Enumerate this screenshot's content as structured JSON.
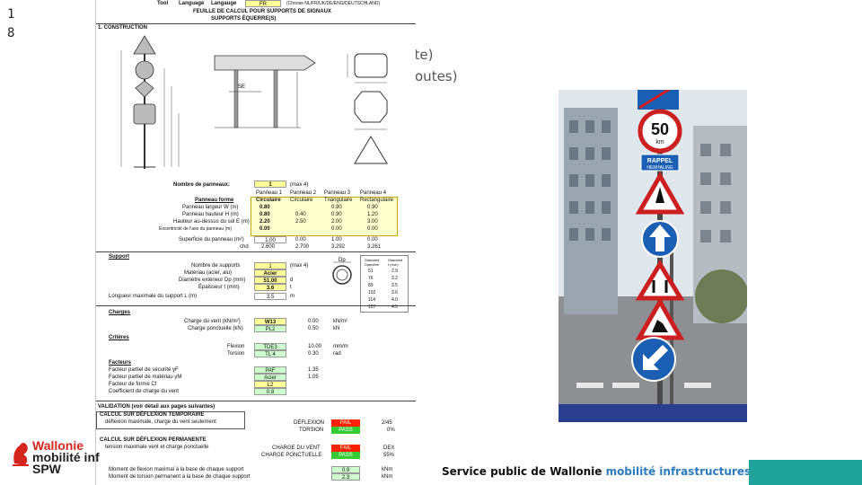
{
  "slide_number": "1 8",
  "background_text": [
    "ute)",
    "iroutes)"
  ],
  "sheet": {
    "header": {
      "tool": "Tool",
      "language_label": "Language",
      "language_label2": "Langauge",
      "language_value": "FR",
      "note": "(Choose NL/FR/UK/DE/ENG/DEUTSCHLAND)"
    },
    "title_line1": "FEUILLE DE CALCUL POUR SUPPORTS DE SIGNAUX",
    "title_line2": "SUPPORTS ÉQUERRE(S)",
    "section1": "1. CONSTRUCTION",
    "panels_count_label": "Nombre de panneaux:",
    "panels_count_value": "1",
    "panels_count_note": "(max 4)",
    "panel_headers": [
      "Panneau 1",
      "Panneau 2",
      "Panneau 3",
      "Panneau 4"
    ],
    "panel_rows": [
      {
        "label": "Panneau forme",
        "values": [
          "Circulaire",
          "Circulaire",
          "Triangulaire",
          "Rectangulaire"
        ]
      },
      {
        "label": "Panneau largeur W (m)",
        "values": [
          "0.80",
          "",
          "0.90",
          "0.90"
        ]
      },
      {
        "label": "Panneau hauteur H (m)",
        "values": [
          "0.80",
          "0.40",
          "0.90",
          "1.20"
        ]
      },
      {
        "label": "Hauteur au-dessus du sol E (m)",
        "values": [
          "2.20",
          "2.50",
          "2.00",
          "3.00"
        ]
      },
      {
        "label": "Excentricité de l'axe du panneau (m)",
        "values": [
          "0.00",
          "",
          "0.00",
          "0.00"
        ]
      },
      {
        "label": "Superficie du panneau (m²)",
        "values": [
          "1.00",
          "0.00",
          "1.00",
          "0.00"
        ]
      },
      {
        "label": "chd",
        "values": [
          "2.600",
          "2.700",
          "3.292",
          "3.261"
        ]
      }
    ],
    "support_title": "Support",
    "support_rows": [
      {
        "label": "Nombre de supports",
        "value": "1",
        "unit": "(max 4)"
      },
      {
        "label": "Matériau (acier, alu)",
        "value": "Acier",
        "unit": ""
      },
      {
        "label": "Diamètre extérieur Dp (mm)",
        "value": "51.00",
        "unit": "d"
      },
      {
        "label": "Épaisseur t (mm)",
        "value": "3.6",
        "unit": "t"
      }
    ],
    "support_length_label": "Longueur maximale du support L (m)",
    "support_length_value": "3.5",
    "support_length_unit": "m",
    "charges_title": "Charges",
    "charges_rows": [
      {
        "label": "Charge du vent (kN/m²)",
        "code": "W13",
        "value": "0.00",
        "unit": "kN/m²"
      },
      {
        "label": "Charge ponctuelle (kN)",
        "code": "PL2",
        "value": "0.50",
        "unit": "kN"
      }
    ],
    "criteres_title": "Critères",
    "criteres_rows": [
      {
        "label": "Flexion",
        "code": "TDE3",
        "value": "10.00",
        "unit": "mm/m"
      },
      {
        "label": "Torsion",
        "code": "TL 4",
        "value": "0.30",
        "unit": "rad"
      }
    ],
    "facteurs_title": "Facteurs",
    "facteurs_rows": [
      {
        "label": "Facteur partiel de sécurité γF",
        "code": "PAF",
        "value": "1.35"
      },
      {
        "label": "Facteur partiel de matériau γM",
        "code": "Acier",
        "value": "1.05"
      },
      {
        "label": "Facteur de forme Cf",
        "code": "L2",
        "value": ""
      },
      {
        "label": "Coefficient de charge du vent",
        "code": "0.8",
        "value": ""
      }
    ],
    "validation_title": "VALIDATION (voir détail aux pages suivantes)",
    "calc_temp_title": "CALCUL SUR DÉFLEXION TEMPORAIRE",
    "calc_temp_sub": "déflexion maximale, charge du vent seulement",
    "calc_temp_rows": [
      {
        "label": "DÉFLEXION",
        "status": "FAIL",
        "value": "2/45"
      },
      {
        "label": "TORSION",
        "status": "PASS",
        "value": "0%"
      }
    ],
    "calc_perm_title": "CALCUL SUR DÉFLEXION PERMANENTE",
    "calc_perm_sub": "tension maximale vent et charge ponctuelle",
    "calc_perm_rows": [
      {
        "label": "CHARGE DU VENT",
        "status": "FAIL",
        "value": "DEX"
      },
      {
        "label": "CHARGE PONCTUELLE",
        "status": "PASS",
        "value": "55%"
      }
    ],
    "moment_rows": [
      {
        "label": "Moment de flexion maximal à la base de chaque support",
        "value": "0.9",
        "unit": "kNm"
      },
      {
        "label": "Moment de torsion permanent à la base de chaque support",
        "value": "2.3",
        "unit": "kNm"
      }
    ],
    "table_right": {
      "headers": [
        "Standard",
        "Standard"
      ],
      "sub_headers": [
        "Diamètre",
        "t (mm)"
      ],
      "rows": [
        [
          "51",
          "2.9"
        ],
        [
          "76",
          "3.2"
        ],
        [
          "89",
          "3.5"
        ],
        [
          "102",
          "3.6"
        ],
        [
          "114",
          "4.0"
        ],
        [
          "127",
          "4.5"
        ]
      ]
    },
    "diagram_labels": {
      "se": "SE",
      "w": "W",
      "h": "H",
      "e": "E",
      "dp": "Dp",
      "t": "t"
    }
  },
  "sign_text": {
    "speed": "50",
    "km": "km",
    "rappel": "RAPPEL",
    "herhaling": "HERHALING"
  },
  "footer": {
    "text": "Service public de Wallonie ",
    "accent": "mobilité infrastructures"
  },
  "logo": {
    "line1": "Wallonie",
    "line2": "mobilité inf",
    "line3": "SPW"
  },
  "colors": {
    "teal": "#20a39b",
    "accent_blue": "#2a7bc0",
    "logo_red": "#d4261c",
    "sign_blue": "#1a5fb4",
    "sign_red": "#cc1f1f"
  }
}
